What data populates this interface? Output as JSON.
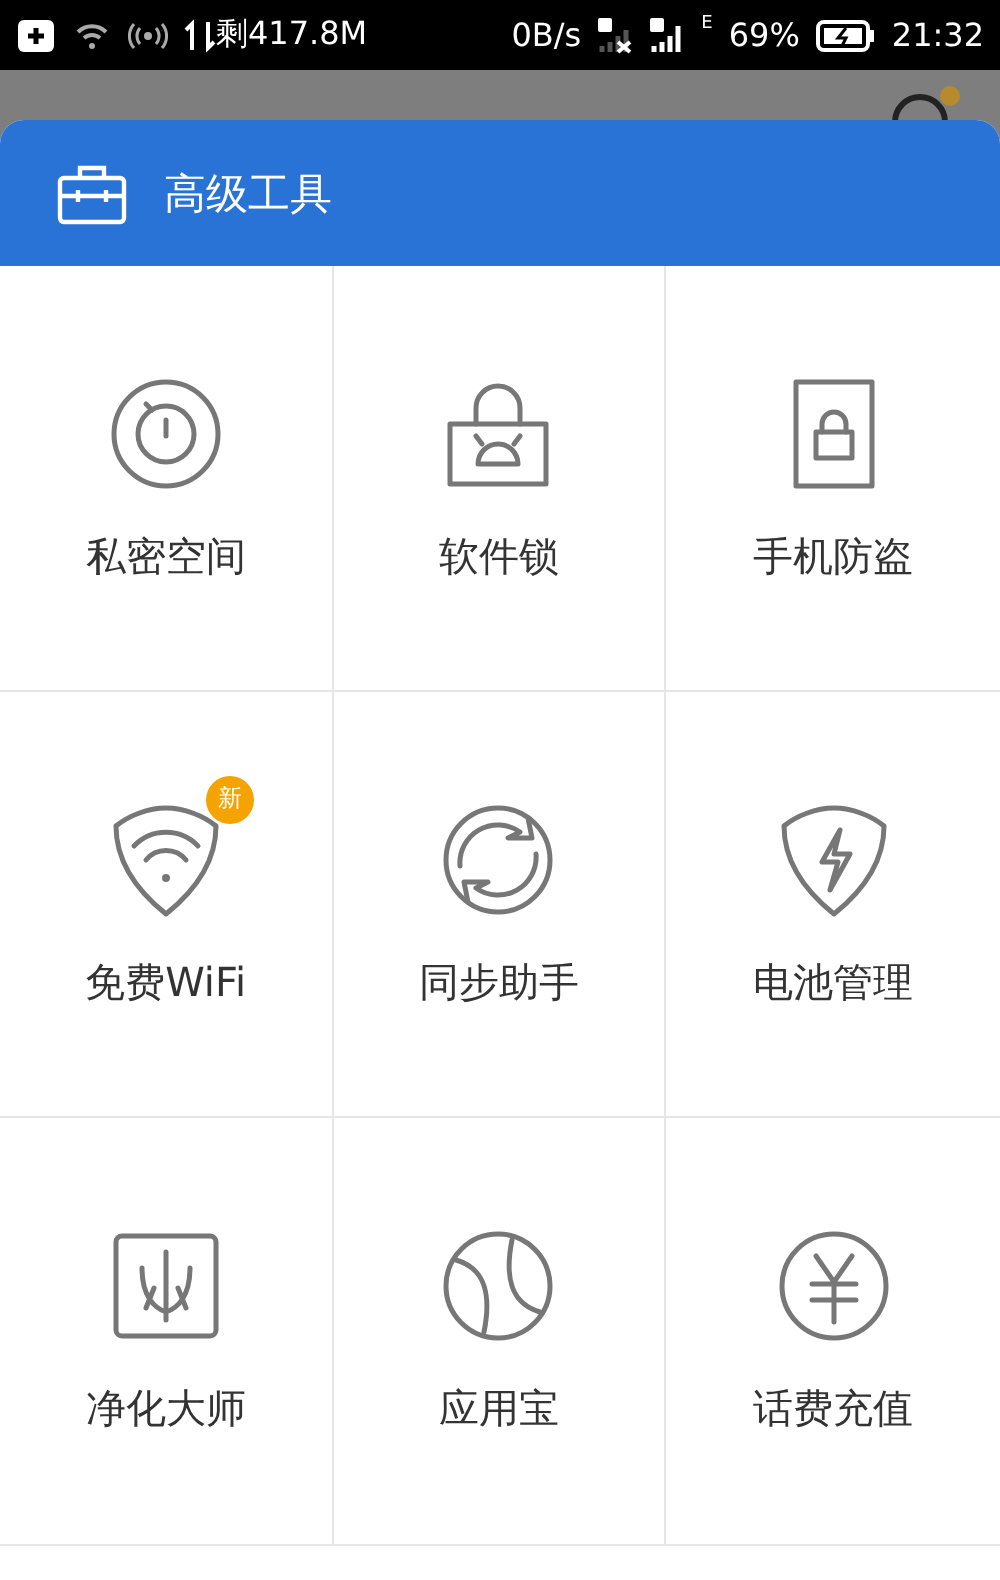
{
  "status_bar": {
    "data_left": "剩417.8M",
    "speed": "0B/s",
    "network_type": "E",
    "battery": "69%",
    "time": "21:32"
  },
  "panel": {
    "title": "高级工具"
  },
  "tools": [
    {
      "label": "私密空间"
    },
    {
      "label": "软件锁"
    },
    {
      "label": "手机防盗"
    },
    {
      "label": "免费WiFi",
      "badge": "新"
    },
    {
      "label": "同步助手"
    },
    {
      "label": "电池管理"
    },
    {
      "label": "净化大师"
    },
    {
      "label": "应用宝"
    },
    {
      "label": "话费充值"
    }
  ]
}
